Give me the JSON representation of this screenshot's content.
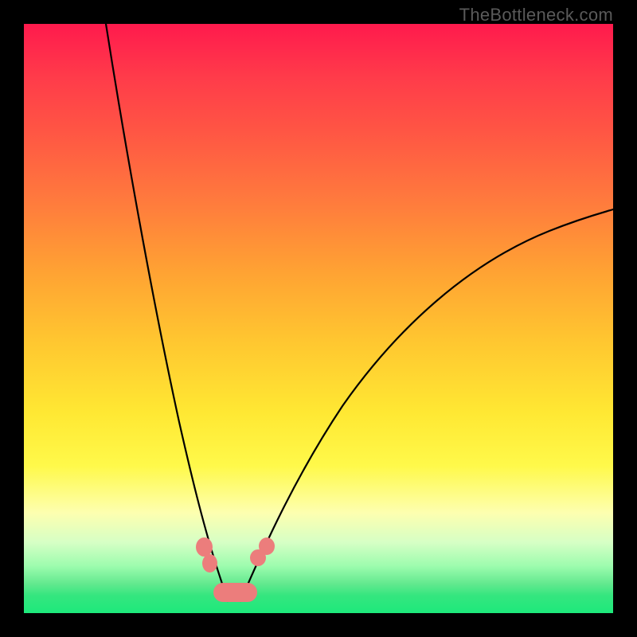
{
  "attribution": "TheBottleneck.com",
  "colors": {
    "background": "#000000",
    "curve": "#000000",
    "marker": "#ec7d7c",
    "gradient_stops": [
      "#ff1a4d",
      "#ff3b4a",
      "#ff5544",
      "#ff7a3d",
      "#ffa233",
      "#ffc730",
      "#ffe833",
      "#fff94a",
      "#fdffb0",
      "#d6ffc5",
      "#9dfcae",
      "#63e98f",
      "#35e67f",
      "#1de97b"
    ]
  },
  "chart_data": {
    "type": "line",
    "title": "",
    "xlabel": "",
    "ylabel": "",
    "grid": false,
    "legend": false,
    "xlim": [
      0,
      100
    ],
    "ylim": [
      0,
      100
    ],
    "series": [
      {
        "name": "left-curve",
        "x": [
          14,
          16,
          18,
          20,
          22,
          24,
          26,
          28,
          30,
          32,
          33,
          34
        ],
        "y": [
          100,
          90,
          78,
          65,
          52,
          40,
          29,
          20,
          13,
          7,
          4,
          2
        ]
      },
      {
        "name": "right-curve",
        "x": [
          37,
          39,
          42,
          46,
          52,
          60,
          70,
          82,
          94,
          100
        ],
        "y": [
          2,
          5,
          9,
          15,
          24,
          35,
          46,
          56,
          63,
          67
        ]
      }
    ],
    "markers": [
      {
        "name": "left-upper-dot",
        "x": 30.5,
        "y": 12,
        "shape": "circle"
      },
      {
        "name": "left-lower-dot",
        "x": 31.5,
        "y": 9,
        "shape": "circle"
      },
      {
        "name": "right-upper-dot",
        "x": 40,
        "y": 10,
        "shape": "circle"
      },
      {
        "name": "right-lower-dot",
        "x": 41.5,
        "y": 12,
        "shape": "circle"
      },
      {
        "name": "valley-pill",
        "x": 35.5,
        "y": 2,
        "shape": "pill"
      }
    ],
    "note": "Axis values are read off the image's proportional coordinate system; no tick labels or units are present."
  }
}
